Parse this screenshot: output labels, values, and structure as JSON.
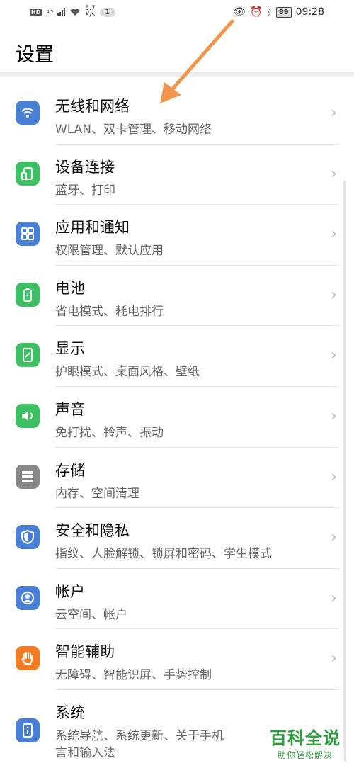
{
  "status_bar": {
    "hd": "HD",
    "network": "4G",
    "speed_value": "5.7",
    "speed_unit": "K/s",
    "notification_count": "1",
    "battery": "89",
    "time": "09:28"
  },
  "page_title": "设置",
  "settings": [
    {
      "title": "无线和网络",
      "subtitle": "WLAN、双卡管理、移动网络",
      "icon": "wifi-icon",
      "color": "#4a7fd6"
    },
    {
      "title": "设备连接",
      "subtitle": "蓝牙、打印",
      "icon": "device-connection-icon",
      "color": "#3cc063"
    },
    {
      "title": "应用和通知",
      "subtitle": "权限管理、默认应用",
      "icon": "apps-icon",
      "color": "#4a7fd6"
    },
    {
      "title": "电池",
      "subtitle": "省电模式、耗电排行",
      "icon": "battery-icon",
      "color": "#3cc063"
    },
    {
      "title": "显示",
      "subtitle": "护眼模式、桌面风格、壁纸",
      "icon": "display-icon",
      "color": "#3cc063"
    },
    {
      "title": "声音",
      "subtitle": "免打扰、铃声、振动",
      "icon": "sound-icon",
      "color": "#3cc063"
    },
    {
      "title": "存储",
      "subtitle": "内存、空间清理",
      "icon": "storage-icon",
      "color": "#888888"
    },
    {
      "title": "安全和隐私",
      "subtitle": "指纹、人脸解锁、锁屏和密码、学生模式",
      "icon": "shield-icon",
      "color": "#4a7fd6"
    },
    {
      "title": "帐户",
      "subtitle": "云空间、帐户",
      "icon": "account-icon",
      "color": "#4a7fd6"
    },
    {
      "title": "智能辅助",
      "subtitle": "无障碍、智能识屏、手势控制",
      "icon": "hand-icon",
      "color": "#f07b22"
    },
    {
      "title": "系统",
      "subtitle": "系统导航、系统更新、关于手机",
      "subtitle2": "言和输入法",
      "icon": "system-info-icon",
      "color": "#4a7fd6"
    }
  ],
  "chevron": "›",
  "watermark": {
    "line1": "百科全说",
    "line2": "助你轻松解决"
  },
  "colors": {
    "arrow": "#f0954a",
    "watermark": "#2d9b3e"
  }
}
